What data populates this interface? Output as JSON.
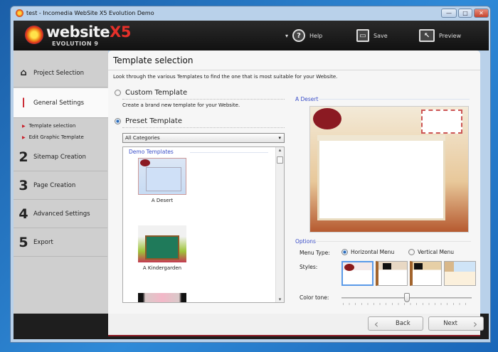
{
  "window": {
    "title": "test - Incomedia WebSite X5 Evolution Demo",
    "controls": {
      "minimize": "—",
      "maximize": "□",
      "close": "✕"
    }
  },
  "logo": {
    "brand": "website",
    "brand_suffix": "X5",
    "edition": "EVOLUTION 9"
  },
  "toolbar": {
    "help": "Help",
    "save": "Save",
    "preview": "Preview",
    "dropdown_arrow": "▾"
  },
  "sidebar": {
    "items": [
      {
        "num": "",
        "label": "Project Selection",
        "icon": "home-icon"
      },
      {
        "num": "I",
        "label": "General Settings"
      },
      {
        "num": "2",
        "label": "Sitemap Creation"
      },
      {
        "num": "3",
        "label": "Page Creation"
      },
      {
        "num": "4",
        "label": "Advanced Settings"
      },
      {
        "num": "5",
        "label": "Export"
      }
    ],
    "sub_items": [
      {
        "label": "Template selection"
      },
      {
        "label": "Edit Graphic Template"
      }
    ],
    "bullet": "▶"
  },
  "panel": {
    "title": "Template selection",
    "description": "Look through the various Templates to find the one that is most suitable for your Website.",
    "custom": {
      "label": "Custom Template",
      "description": "Create a brand new template for your Website.",
      "selected": false
    },
    "preset": {
      "label": "Preset Template",
      "selected": true
    },
    "category_select": {
      "value": "All Categories",
      "arrow": "▾"
    },
    "list": {
      "group": "Demo Templates",
      "items": [
        {
          "name": "A Desert"
        },
        {
          "name": "A Kindergarden"
        },
        {
          "name": ""
        }
      ]
    },
    "scroll": {
      "up": "▴",
      "down": "▾"
    },
    "selected_template": "A Desert",
    "options": {
      "title": "Options",
      "menu_type_label": "Menu Type:",
      "menu_types": [
        {
          "label": "Horizontal Menu",
          "selected": true
        },
        {
          "label": "Vertical Menu",
          "selected": false
        }
      ],
      "styles_label": "Styles:",
      "selected_style": 1,
      "color_tone_label": "Color tone:",
      "color_tone_value": 0.5
    }
  },
  "footer": {
    "back": "Back",
    "next": "Next",
    "back_icon": "‹",
    "next_icon": "›"
  },
  "colors": {
    "accent": "#c8202a",
    "link_blue": "#3a4ec8",
    "header": "#1a1a1a"
  }
}
